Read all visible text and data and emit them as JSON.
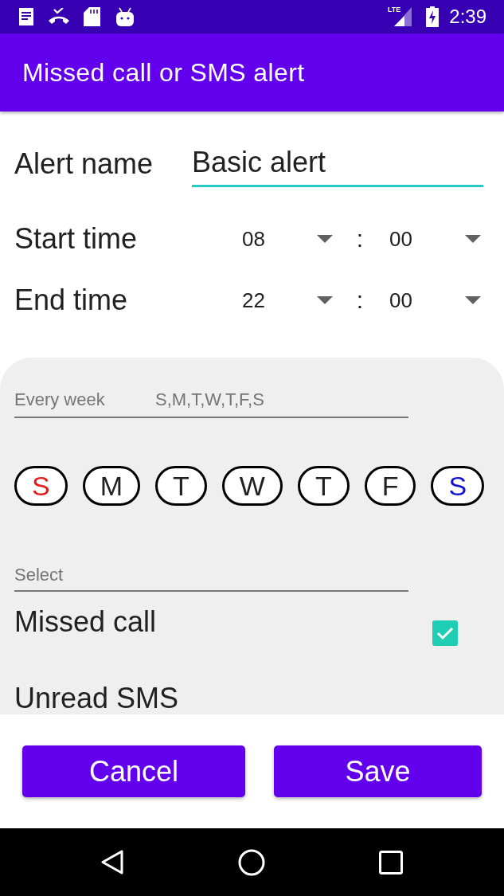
{
  "status_bar": {
    "network": "LTE",
    "time": "2:39"
  },
  "app_bar": {
    "title": "Missed call or SMS alert"
  },
  "alert_name": {
    "label": "Alert name",
    "value": "Basic alert"
  },
  "times": [
    {
      "label": "Start time",
      "hour": "08",
      "separator": ":",
      "minute": "00"
    },
    {
      "label": "End time",
      "hour": "22",
      "separator": ":",
      "minute": "00"
    }
  ],
  "repeat": {
    "label": "Every week",
    "value": "S,M,T,W,T,F,S"
  },
  "days": [
    {
      "label": "S",
      "color": "#e31b1b"
    },
    {
      "label": "M",
      "color": "#212121"
    },
    {
      "label": "T",
      "color": "#212121"
    },
    {
      "label": "W",
      "color": "#212121"
    },
    {
      "label": "T",
      "color": "#212121"
    },
    {
      "label": "F",
      "color": "#212121"
    },
    {
      "label": "S",
      "color": "#1010d0"
    }
  ],
  "select": {
    "placeholder": "Select"
  },
  "options": [
    {
      "label": "Missed call",
      "checked": true
    },
    {
      "label": "Unread SMS"
    }
  ],
  "buttons": [
    {
      "label": "Cancel"
    },
    {
      "label": "Save"
    }
  ]
}
